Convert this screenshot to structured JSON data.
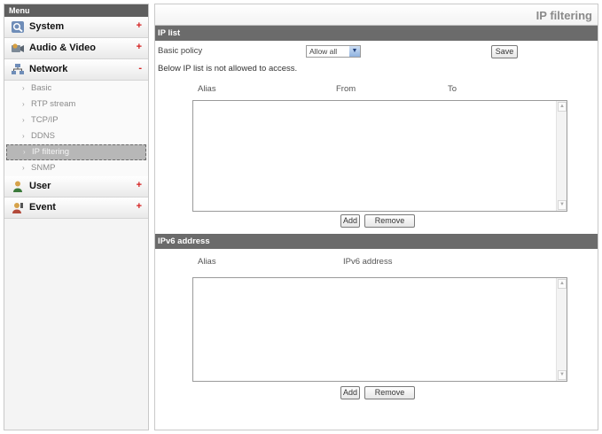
{
  "sidebar": {
    "menu_label": "Menu",
    "categories": [
      {
        "label": "System",
        "icon": "magnifier-icon",
        "mark": "+"
      },
      {
        "label": "Audio & Video",
        "icon": "camera-icon",
        "mark": "+"
      },
      {
        "label": "Network",
        "icon": "network-icon",
        "mark": "-"
      },
      {
        "label": "User",
        "icon": "user-icon",
        "mark": "+"
      },
      {
        "label": "Event",
        "icon": "event-icon",
        "mark": "+"
      }
    ],
    "network_items": [
      {
        "label": "Basic"
      },
      {
        "label": "RTP stream"
      },
      {
        "label": "TCP/IP"
      },
      {
        "label": "DDNS"
      },
      {
        "label": "IP filtering",
        "active": true
      },
      {
        "label": "SNMP"
      }
    ],
    "arrow_glyph": "›"
  },
  "main": {
    "page_title": "IP filtering",
    "ip_list": {
      "section_title": "IP list",
      "basic_policy_label": "Basic policy",
      "basic_policy_value": "Allow all",
      "save_label": "Save",
      "notice": "Below IP list is not allowed to access.",
      "columns": [
        "Alias",
        "From",
        "To"
      ],
      "add_label": "Add",
      "remove_label": "Remove"
    },
    "ipv6": {
      "section_title": "IPv6 address",
      "columns": [
        "Alias",
        "IPv6 address"
      ],
      "add_label": "Add",
      "remove_label": "Remove"
    }
  },
  "colors": {
    "section_bar": "#6b6b6b",
    "active_item": "#b7b7b7",
    "expand_mark": "#d42020"
  }
}
